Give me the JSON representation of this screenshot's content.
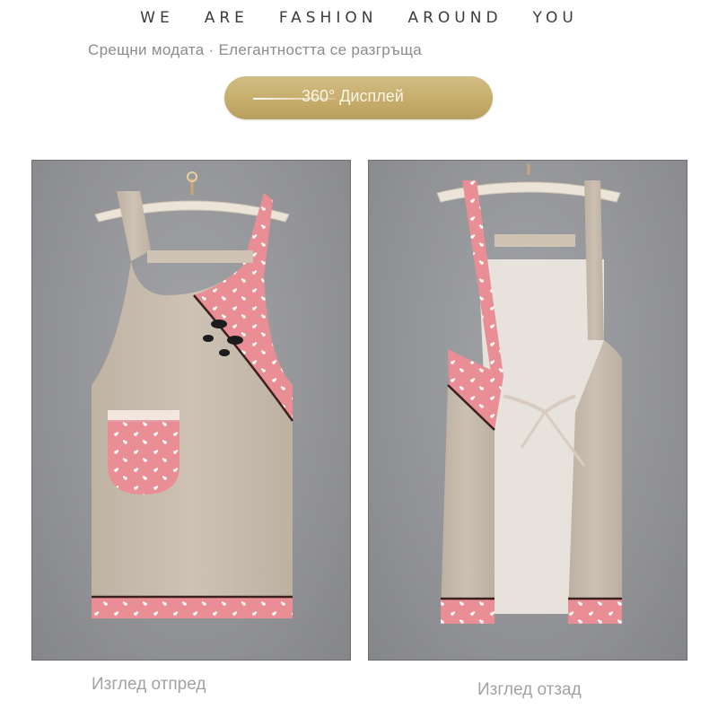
{
  "header": {
    "headline_words": [
      "WE",
      "ARE",
      "FASHION",
      "AROUND",
      "YOU"
    ],
    "subtitle": "Срещни модата · Елегантността се разгръща",
    "display_button": "360° Дисплей"
  },
  "views": {
    "front": {
      "caption": "Изглед отпред"
    },
    "back": {
      "caption": "Изглед отзад"
    }
  },
  "colors": {
    "linen": "#c9bdae",
    "floral_pink": "#e98e95",
    "gold_button": "#c6ad6c",
    "background_gray": "#8f9093"
  }
}
